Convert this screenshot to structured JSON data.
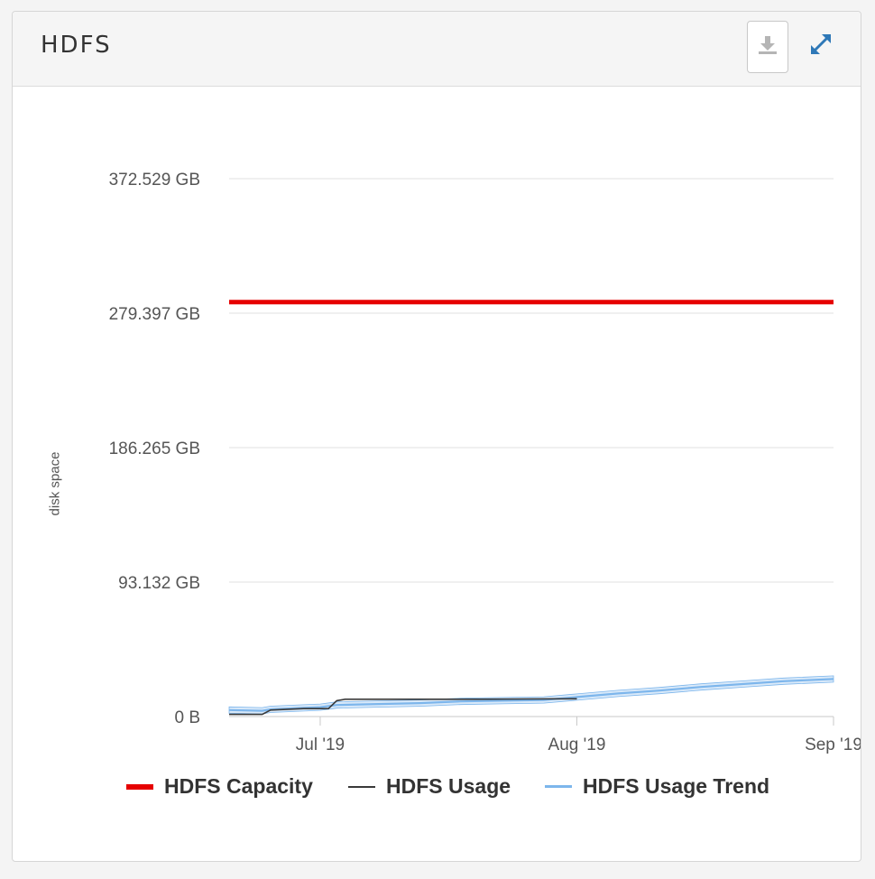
{
  "panel": {
    "title": "HDFS",
    "download_icon": "download-icon",
    "expand_icon": "expand-icon"
  },
  "colors": {
    "capacity": "#e60000",
    "usage": "#3a3a3a",
    "trend": "#7db6ec",
    "trend_band": "#b9d7f4",
    "grid": "#e0e0e0"
  },
  "chart_data": {
    "type": "line",
    "title": "",
    "ylabel": "disk space",
    "xlabel": "",
    "ylim": [
      0,
      372.529
    ],
    "y_unit": "GB",
    "y_ticks": [
      "0 B",
      "93.132 GB",
      "186.265 GB",
      "279.397 GB",
      "372.529 GB"
    ],
    "y_tick_values": [
      0,
      93.132,
      186.265,
      279.397,
      372.529
    ],
    "x_range": [
      "2019-06-20",
      "2019-09-01"
    ],
    "x_ticks": [
      {
        "label": "Jul '19",
        "date": "2019-07-01"
      },
      {
        "label": "Aug '19",
        "date": "2019-08-01"
      },
      {
        "label": "Sep '19",
        "date": "2019-09-01"
      }
    ],
    "grid": true,
    "legend_position": "bottom",
    "series": [
      {
        "name": "HDFS Capacity",
        "key": "capacity",
        "x": [
          "2019-06-20",
          "2019-09-01"
        ],
        "y": [
          287.0,
          287.0
        ]
      },
      {
        "name": "HDFS Usage",
        "key": "usage",
        "x": [
          "2019-06-20",
          "2019-06-24",
          "2019-06-25",
          "2019-06-29",
          "2019-07-02",
          "2019-07-03",
          "2019-07-04",
          "2019-07-08",
          "2019-07-14",
          "2019-07-20",
          "2019-07-26",
          "2019-08-01"
        ],
        "y": [
          1.5,
          1.5,
          4.5,
          5.5,
          5.5,
          11.0,
          12.0,
          12.0,
          12.0,
          12.0,
          12.2,
          12.3
        ]
      },
      {
        "name": "HDFS Usage Trend",
        "key": "trend",
        "x": [
          "2019-06-20",
          "2019-06-24",
          "2019-06-25",
          "2019-06-29",
          "2019-07-01",
          "2019-07-03",
          "2019-07-08",
          "2019-07-13",
          "2019-07-18",
          "2019-07-23",
          "2019-07-28",
          "2019-08-01",
          "2019-08-06",
          "2019-08-11",
          "2019-08-16",
          "2019-08-21",
          "2019-08-26",
          "2019-09-01"
        ],
        "y": [
          4.5,
          4.0,
          5.0,
          6.0,
          6.5,
          8.0,
          8.7,
          9.3,
          10.5,
          11.0,
          11.5,
          13.5,
          16.0,
          18.0,
          20.5,
          22.5,
          24.5,
          26.0
        ]
      }
    ]
  }
}
